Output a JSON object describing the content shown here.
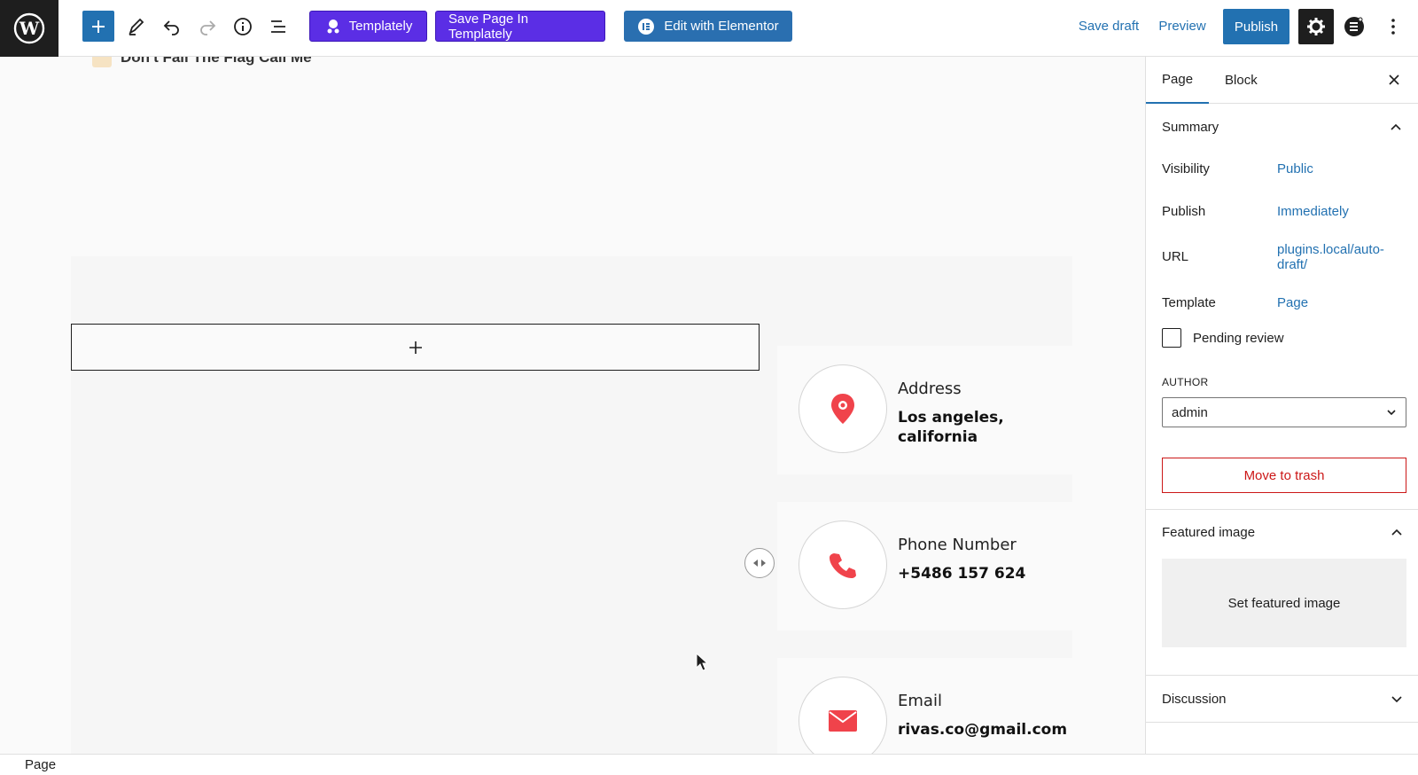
{
  "toolbar": {
    "templately_label": "Templately",
    "save_templately_label": "Save Page In Templately",
    "elementor_label": "Edit with Elementor",
    "save_draft_label": "Save draft",
    "preview_label": "Preview",
    "publish_label": "Publish"
  },
  "canvas": {
    "heading_peek": "Don't Fail The Flag Call Me",
    "contacts": [
      {
        "label": "Address",
        "value": "Los angeles, california",
        "icon": "map-pin-icon"
      },
      {
        "label": "Phone Number",
        "value": "+5486 157 624",
        "icon": "phone-icon"
      },
      {
        "label": "Email",
        "value": "rivas.co@gmail.com",
        "icon": "mail-icon"
      }
    ],
    "accent_color": "#f0434b"
  },
  "sidebar": {
    "tabs": [
      "Page",
      "Block"
    ],
    "summary_title": "Summary",
    "rows": [
      {
        "label": "Visibility",
        "value": "Public"
      },
      {
        "label": "Publish",
        "value": "Immediately"
      },
      {
        "label": "URL",
        "value": "plugins.local/auto-draft/"
      },
      {
        "label": "Template",
        "value": "Page"
      }
    ],
    "pending_review_label": "Pending review",
    "author_label": "AUTHOR",
    "author_value": "admin",
    "trash_label": "Move to trash",
    "featured_image_title": "Featured image",
    "set_featured_label": "Set featured image",
    "discussion_title": "Discussion"
  },
  "statusbar": {
    "breadcrumb": "Page"
  }
}
